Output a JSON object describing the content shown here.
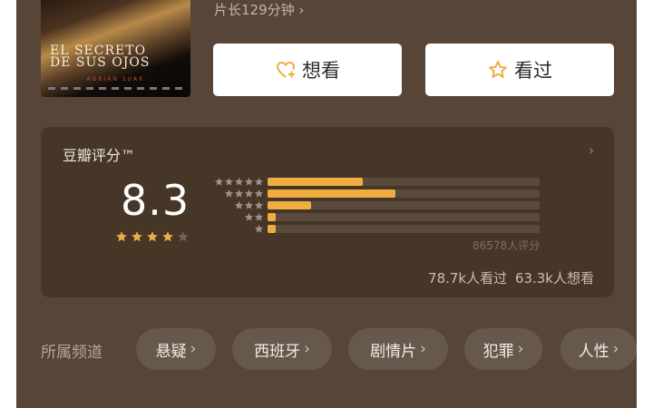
{
  "header": {
    "duration_text": "片长129分钟",
    "duration_chevron": "›",
    "poster_title_lines": [
      "EL SECRETO",
      "DE SUS OJOS"
    ],
    "poster_subtitle": "ADRIÁN SUAR"
  },
  "actions": {
    "want_label": "想看",
    "seen_label": "看过",
    "icon_color": "#f0ae42"
  },
  "rating": {
    "title": "豆瓣评分™",
    "chevron": "›",
    "score": "8.3",
    "star_level": 4,
    "star_total": 5,
    "distribution": [
      {
        "stars": 5,
        "fraction": 0.35
      },
      {
        "stars": 4,
        "fraction": 0.47
      },
      {
        "stars": 3,
        "fraction": 0.16
      },
      {
        "stars": 2,
        "fraction": 0.03
      },
      {
        "stars": 1,
        "fraction": 0.03
      }
    ],
    "rating_count": "86578人评分",
    "seen_text": "78.7k人看过",
    "want_text": "63.3k人想看",
    "bar_color": "#f0ae42",
    "star_color": "#f0ae42"
  },
  "channels": {
    "label": "所属频道",
    "chip_chevron": "›",
    "items": [
      "悬疑",
      "西班牙",
      "剧情片",
      "犯罪",
      "人性"
    ]
  }
}
